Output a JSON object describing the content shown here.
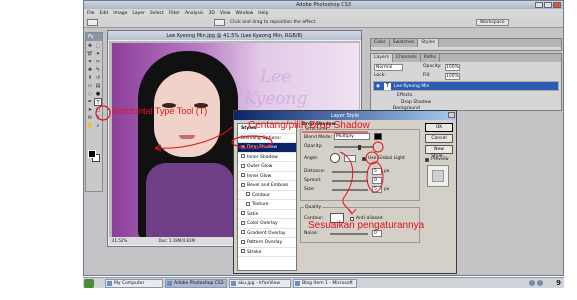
{
  "window": {
    "title": "Adobe Photoshop CS3"
  },
  "menu": [
    "File",
    "Edit",
    "Image",
    "Layer",
    "Select",
    "Filter",
    "Analysis",
    "3D",
    "View",
    "Window",
    "Help"
  ],
  "options_bar": {
    "hint": "Click and drag to reposition the effect.",
    "workspace_label": "Workspace"
  },
  "toolbox": {
    "header": "Ps"
  },
  "document": {
    "title": "Lee Kyeong Min.jpg @ 41.5% (Lee Kyeong Min, RGB/8)",
    "zoom": "41.52%",
    "doc_size": "Doc: 1.18M/4.81M",
    "watermark_line1": "Lee",
    "watermark_line2": "Kyeong"
  },
  "panels": {
    "color_tabs": [
      "Color",
      "Swatches",
      "Styles"
    ],
    "layers_tabs": [
      "Layers",
      "Channels",
      "Paths"
    ],
    "blend_mode": "Normal",
    "opacity_label": "Opacity:",
    "opacity_value": "100%",
    "lock_label": "Lock:",
    "fill_label": "Fill:",
    "fill_value": "100%",
    "layer_name": "Lee Kyeong Min",
    "effects_label": "Effects",
    "drop_shadow_effect": "Drop Shadow",
    "background_layer": "Background"
  },
  "dialog": {
    "title": "Layer Style",
    "styles": [
      {
        "label": "Styles",
        "checkbox": false
      },
      {
        "label": "Blending Options: Default",
        "checkbox": false
      },
      {
        "label": "Drop Shadow",
        "checkbox": true
      },
      {
        "label": "Inner Shadow",
        "checkbox": true
      },
      {
        "label": "Outer Glow",
        "checkbox": true
      },
      {
        "label": "Inner Glow",
        "checkbox": true
      },
      {
        "label": "Bevel and Emboss",
        "checkbox": true
      },
      {
        "label": "Contour",
        "checkbox": true
      },
      {
        "label": "Texture",
        "checkbox": true
      },
      {
        "label": "Satin",
        "checkbox": true
      },
      {
        "label": "Color Overlay",
        "checkbox": true
      },
      {
        "label": "Gradient Overlay",
        "checkbox": true
      },
      {
        "label": "Pattern Overlay",
        "checkbox": true
      },
      {
        "label": "Stroke",
        "checkbox": true
      }
    ],
    "section_title": "Drop Shadow",
    "structure_label": "Structure",
    "blend_mode_label": "Blend Mode:",
    "blend_mode_value": "Multiply",
    "opacity_label": "Opacity:",
    "angle_label": "Angle:",
    "global_light_label": "Use Global Light",
    "distance_label": "Distance:",
    "distance_value": "5",
    "spread_label": "Spread:",
    "spread_value": "0",
    "size_label": "Size:",
    "size_value": "5",
    "px_unit": "px",
    "quality_label": "Quality",
    "contour_label": "Contour:",
    "anti_aliased_label": "Anti-aliased",
    "noise_label": "Noise:",
    "noise_value": "0",
    "ok_label": "OK",
    "cancel_label": "Cancel",
    "new_style_label": "New Style...",
    "preview_label": "Preview"
  },
  "annotations": {
    "tool": "Horizontal Type Tool (T)",
    "check": "Centang/pilih Drop Shadow",
    "adjust": "Sesuaikan pengaturannya"
  },
  "taskbar": {
    "items": [
      "My Computer",
      "Adobe Photoshop CS3",
      "aku.jpg - IrfanView",
      "Blog Item 1 - Microsoft"
    ],
    "clock": "9"
  },
  "colors": {
    "annotation_red": "#e4111c",
    "selected_blue": "#0a246a",
    "photo_purple": "#8c3f9a"
  },
  "icons": [
    "photoshop-logo-icon",
    "horizontal-type-tool-icon",
    "move-tool-icon",
    "eye-icon",
    "close-icon",
    "ubuntu-start-icon"
  ]
}
